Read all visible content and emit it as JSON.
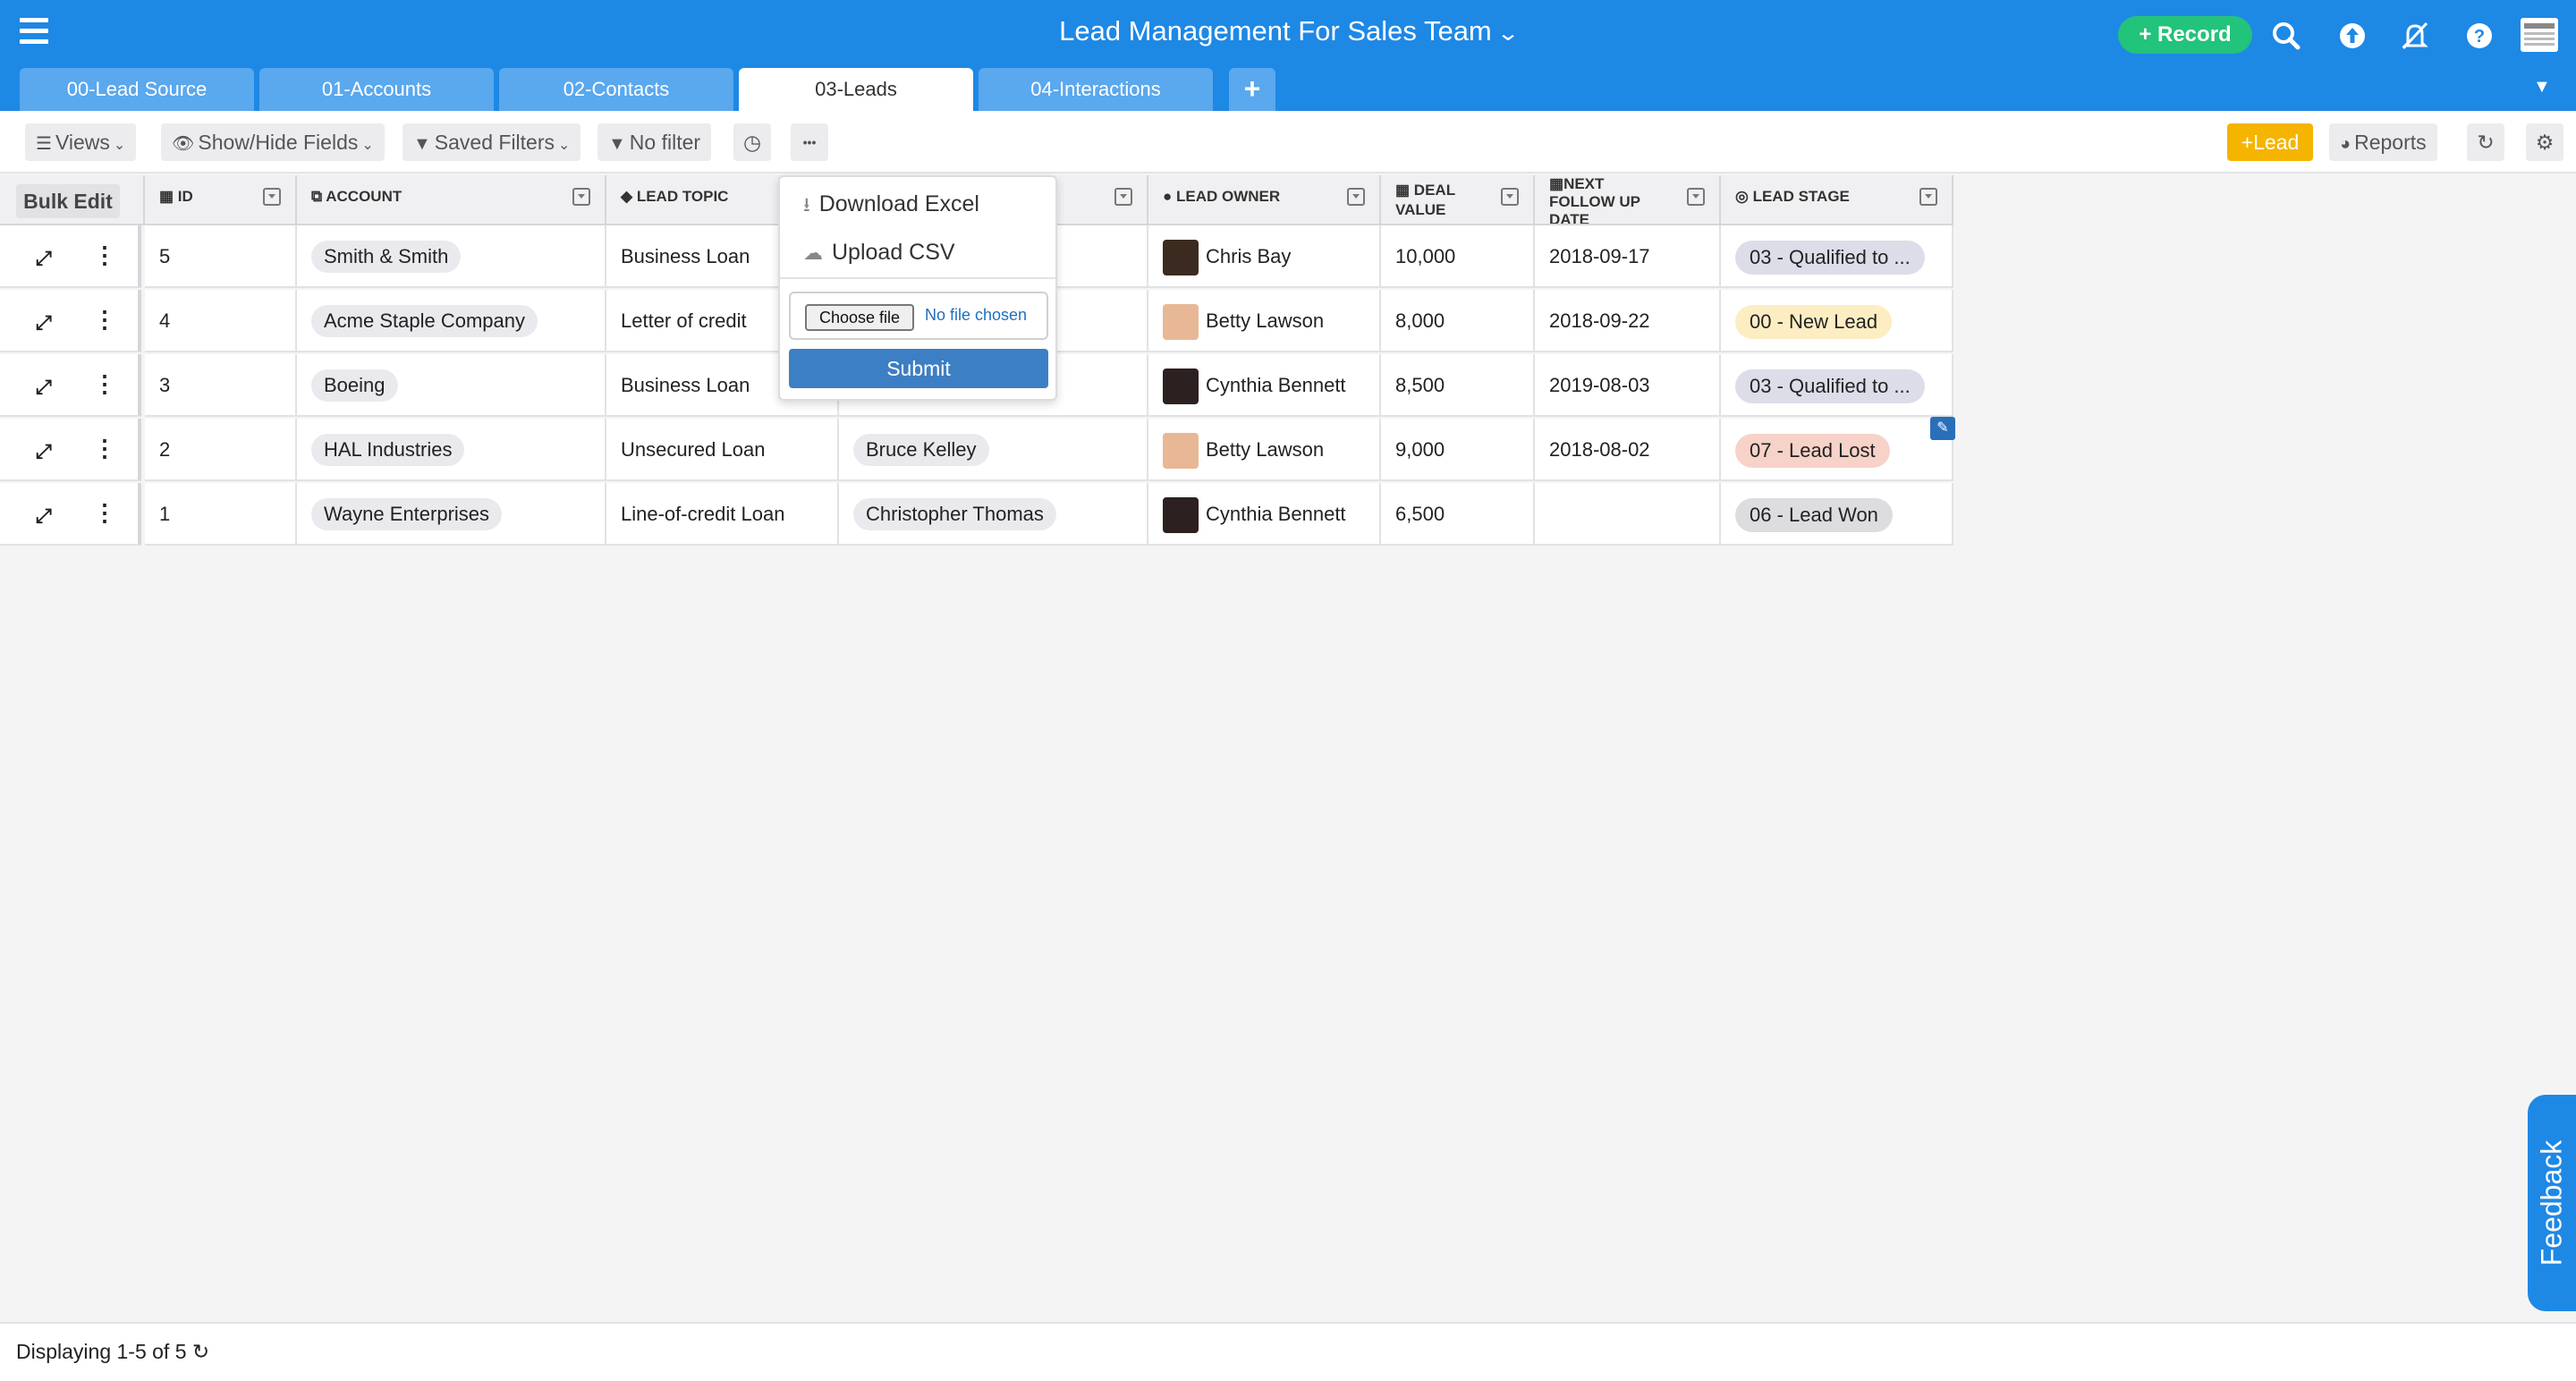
{
  "header": {
    "title": "Lead Management For Sales Team",
    "record_label": "Record",
    "accent_color": "#1e88e5",
    "record_color": "#22c37a",
    "icons": [
      "search-icon",
      "upload-icon",
      "notifications-off-icon",
      "help-icon",
      "keyboard-icon"
    ]
  },
  "tabs": [
    {
      "label": "00-Lead Source"
    },
    {
      "label": "01-Accounts"
    },
    {
      "label": "02-Contacts"
    },
    {
      "label": "03-Leads",
      "active": true
    },
    {
      "label": "04-Interactions"
    }
  ],
  "toolbar": {
    "views": "Views",
    "show_hide": "Show/Hide Fields",
    "saved_filters": "Saved Filters",
    "no_filter": "No filter",
    "more": "•••",
    "lead": "Lead",
    "reports": "Reports"
  },
  "grid": {
    "bulk_edit": "Bulk Edit",
    "columns": {
      "id": "ID",
      "account": "ACCOUNT",
      "lead_topic": "LEAD TOPIC",
      "lead_owner": "LEAD OWNER",
      "deal_value_1": "DEAL",
      "deal_value_2": "VALUE",
      "follow_1": "NEXT",
      "follow_2": "FOLLOW UP",
      "follow_3": "DATE",
      "lead_stage": "LEAD STAGE"
    },
    "rows": [
      {
        "id": "5",
        "account": "Smith & Smith",
        "topic": "Business Loan",
        "contact": "",
        "owner": "Chris Bay",
        "deal": "10,000",
        "date": "2018-09-17",
        "stage": "03 - Qualified to ...",
        "stage_color": "#dcdde8"
      },
      {
        "id": "4",
        "account": "Acme Staple Company",
        "topic": "Letter of credit",
        "contact": "",
        "owner": "Betty Lawson",
        "deal": "8,000",
        "date": "2018-09-22",
        "stage": "00 - New Lead",
        "stage_color": "#fdedc3"
      },
      {
        "id": "3",
        "account": "Boeing",
        "topic": "Business Loan",
        "contact": "",
        "owner": "Cynthia Bennett",
        "deal": "8,500",
        "date": "2019-08-03",
        "stage": "03 - Qualified to ...",
        "stage_color": "#dcdde8"
      },
      {
        "id": "2",
        "account": "HAL Industries",
        "topic": "Unsecured Loan",
        "contact": "Bruce Kelley",
        "owner": "Betty Lawson",
        "deal": "9,000",
        "date": "2018-08-02",
        "stage": "07 - Lead Lost",
        "stage_color": "#f7d2c8"
      },
      {
        "id": "1",
        "account": "Wayne Enterprises",
        "topic": "Line-of-credit Loan",
        "contact": "Christopher Thomas",
        "owner": "Cynthia Bennett",
        "deal": "6,500",
        "date": "",
        "stage": "06 - Lead Won",
        "stage_color": "#dddde0"
      }
    ]
  },
  "dropdown": {
    "download_excel": "Download Excel",
    "upload_csv": "Upload CSV",
    "choose_file": "Choose file",
    "file_status": "No file chosen",
    "submit": "Submit"
  },
  "footer": {
    "display_count": "Displaying 1-5 of 5"
  },
  "feedback": "Feedback"
}
